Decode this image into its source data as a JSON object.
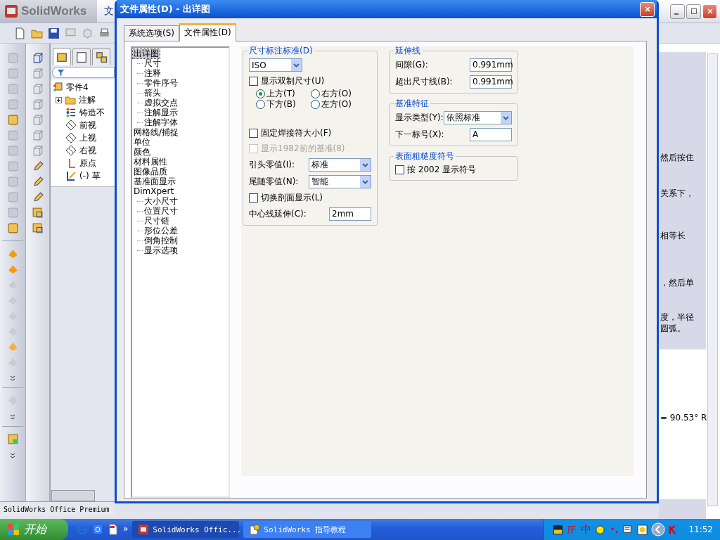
{
  "app": {
    "logo": "SolidWorks",
    "doc_tab": "文",
    "tree": {
      "root": "零件4",
      "items": [
        {
          "label": "注解",
          "kind": "annotation"
        },
        {
          "label": "铸造不",
          "kind": "material"
        },
        {
          "label": "前视",
          "kind": "plane"
        },
        {
          "label": "上视",
          "kind": "plane"
        },
        {
          "label": "右视",
          "kind": "plane"
        },
        {
          "label": "原点",
          "kind": "origin"
        },
        {
          "label": "(-) 草",
          "kind": "sketch"
        }
      ]
    },
    "status": "SolidWorks Office Premium"
  },
  "help": {
    "lines": [
      "然后按住",
      "关系下，",
      "相等长",
      "，然后单",
      "度，半径",
      "圆弧。",
      "= 90.53° R"
    ]
  },
  "dialog": {
    "title": "文件属性(D) - 出详图",
    "tabs": [
      {
        "label": "系统选项(S)",
        "selected": false
      },
      {
        "label": "文件属性(D)",
        "selected": true
      }
    ],
    "tree": [
      {
        "label": "出详图",
        "selected": true,
        "children": [
          {
            "label": "尺寸",
            "selected": false
          },
          {
            "label": "注释",
            "selected": false
          },
          {
            "label": "零件序号",
            "selected": false
          },
          {
            "label": "箭头",
            "selected": false
          },
          {
            "label": "虚拟交点",
            "selected": false
          },
          {
            "label": "注解显示",
            "selected": false
          },
          {
            "label": "注解字体",
            "selected": false
          }
        ]
      },
      {
        "label": "网格线/捕捉",
        "selected": false
      },
      {
        "label": "单位",
        "selected": false
      },
      {
        "label": "颜色",
        "selected": false
      },
      {
        "label": "材料属性",
        "selected": false
      },
      {
        "label": "图像品质",
        "selected": false
      },
      {
        "label": "基准面显示",
        "selected": false
      },
      {
        "label": "DimXpert",
        "selected": false,
        "children": [
          {
            "label": "大小尺寸",
            "selected": false
          },
          {
            "label": "位置尺寸",
            "selected": false
          },
          {
            "label": "尺寸链",
            "selected": false
          },
          {
            "label": "形位公差",
            "selected": false
          },
          {
            "label": "倒角控制",
            "selected": false
          },
          {
            "label": "显示选项",
            "selected": false
          }
        ]
      }
    ],
    "columns": [
      [
        {
          "title": "尺寸标注标准(D)",
          "rows": [
            {
              "kind": "select",
              "value": "ISO"
            },
            {
              "kind": "checkbox",
              "label": "显示双制尺寸(U)",
              "checked": false,
              "disabled": false
            },
            {
              "kind": "radios",
              "options": [
                {
                  "label": "上方(T)",
                  "selected": true
                },
                {
                  "label": "右方(O)",
                  "selected": false
                },
                {
                  "label": "下方(B)",
                  "selected": false
                },
                {
                  "label": "左方(O)",
                  "selected": false
                }
              ]
            },
            {
              "kind": "checkbox",
              "label": "固定焊接符大小(F)",
              "checked": false,
              "disabled": false
            },
            {
              "kind": "checkbox",
              "label": "显示1982前的基准(8)",
              "checked": false,
              "disabled": true
            },
            {
              "kind": "field_select",
              "label": "引头零值(I):",
              "value": "标准"
            },
            {
              "kind": "field_select",
              "label": "尾随零值(N):",
              "value": "智能"
            },
            {
              "kind": "checkbox",
              "label": "切换剖面显示(L)",
              "checked": false,
              "disabled": false
            },
            {
              "kind": "field_input",
              "label": "中心线延伸(C):",
              "value": "2mm"
            }
          ]
        }
      ],
      [
        {
          "title": "延伸线",
          "rows": [
            {
              "kind": "field_input",
              "label": "间隙(G):",
              "value": "0.991mm"
            },
            {
              "kind": "field_input",
              "label": "超出尺寸线(B):",
              "value": "0.991mm"
            }
          ]
        },
        {
          "title": "基准特征",
          "rows": [
            {
              "kind": "field_select",
              "label": "显示类型(Y):",
              "value": "依照标准"
            },
            {
              "kind": "field_input",
              "label": "下一标号(X):",
              "value": "A"
            }
          ]
        },
        {
          "title": "表面粗糙度符号",
          "rows": [
            {
              "kind": "checkbox",
              "label": "按 2002 显示符号",
              "checked": false,
              "disabled": false
            }
          ]
        }
      ]
    ]
  },
  "taskbar": {
    "start": "开始",
    "more": "»",
    "tasks": [
      {
        "label": "SolidWorks Offic...",
        "selected": true
      },
      {
        "label": "SolidWorks 指导教程",
        "selected": false
      }
    ],
    "ime": "中",
    "clock": "11:52"
  }
}
